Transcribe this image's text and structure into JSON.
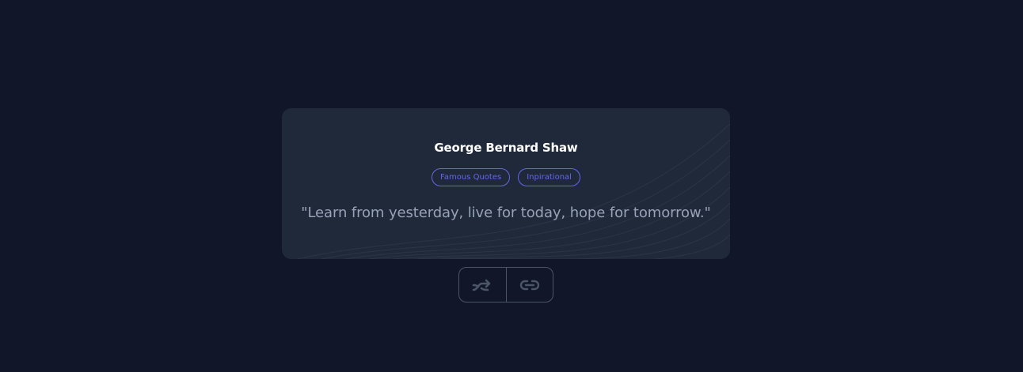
{
  "quote_card": {
    "author": "George Bernard Shaw",
    "tags": [
      "Famous Quotes",
      "Inpirational"
    ],
    "text": "\"Learn from yesterday, live for today, hope for tomorrow.\""
  },
  "actions": {
    "random_icon": "shuffle-icon",
    "copy_link_icon": "link-icon"
  },
  "colors": {
    "background": "#111729",
    "card": "#20293a",
    "accent": "#6466e9",
    "muted": "#97a3b6",
    "border": "#4a5567"
  }
}
